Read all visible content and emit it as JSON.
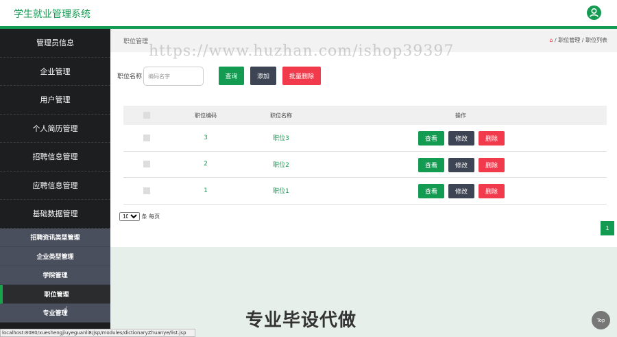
{
  "app": {
    "title": "学生就业管理系统",
    "avatar_icon": "user-icon"
  },
  "sidebar": {
    "items": [
      {
        "label": "管理员信息"
      },
      {
        "label": "企业管理"
      },
      {
        "label": "用户管理"
      },
      {
        "label": "个人简历管理"
      },
      {
        "label": "招聘信息管理"
      },
      {
        "label": "应聘信息管理"
      },
      {
        "label": "基础数据管理"
      }
    ],
    "subitems": [
      {
        "label": "招聘资讯类型管理"
      },
      {
        "label": "企业类型管理"
      },
      {
        "label": "学院管理"
      },
      {
        "label": "职位管理"
      },
      {
        "label": "专业管理"
      }
    ]
  },
  "status_url": "localhost:8080/xueshengjiuyeguanli8/jsp/modules/dictionaryZhuanye/list.jsp",
  "page": {
    "title": "职位管理",
    "breadcrumb": [
      "职位管理",
      "职位列表"
    ],
    "watermark": "https://www.huzhan.com/ishop39397"
  },
  "search": {
    "label": "职位名称",
    "placeholder": "编码名字",
    "value": ""
  },
  "buttons": {
    "query": "查询",
    "add": "添加",
    "batch_delete": "批量删除"
  },
  "table": {
    "headers": [
      "职位编码",
      "职位名称",
      "操作"
    ],
    "rows": [
      {
        "code": "3",
        "name": "职位3"
      },
      {
        "code": "2",
        "name": "职位2"
      },
      {
        "code": "1",
        "name": "职位1"
      }
    ],
    "actions": {
      "view": "查看",
      "edit": "修改",
      "delete": "删除"
    }
  },
  "pagination": {
    "page_size": "10",
    "per_page_label": "条 每页",
    "current_page": "1"
  },
  "overlay": {
    "promo": "专业毕设代做",
    "top_button": "Top"
  },
  "colors": {
    "primary": "#139b52",
    "dark_button": "#3d4453",
    "danger": "#f13b4c",
    "sidebar": "#1c1e1f"
  }
}
